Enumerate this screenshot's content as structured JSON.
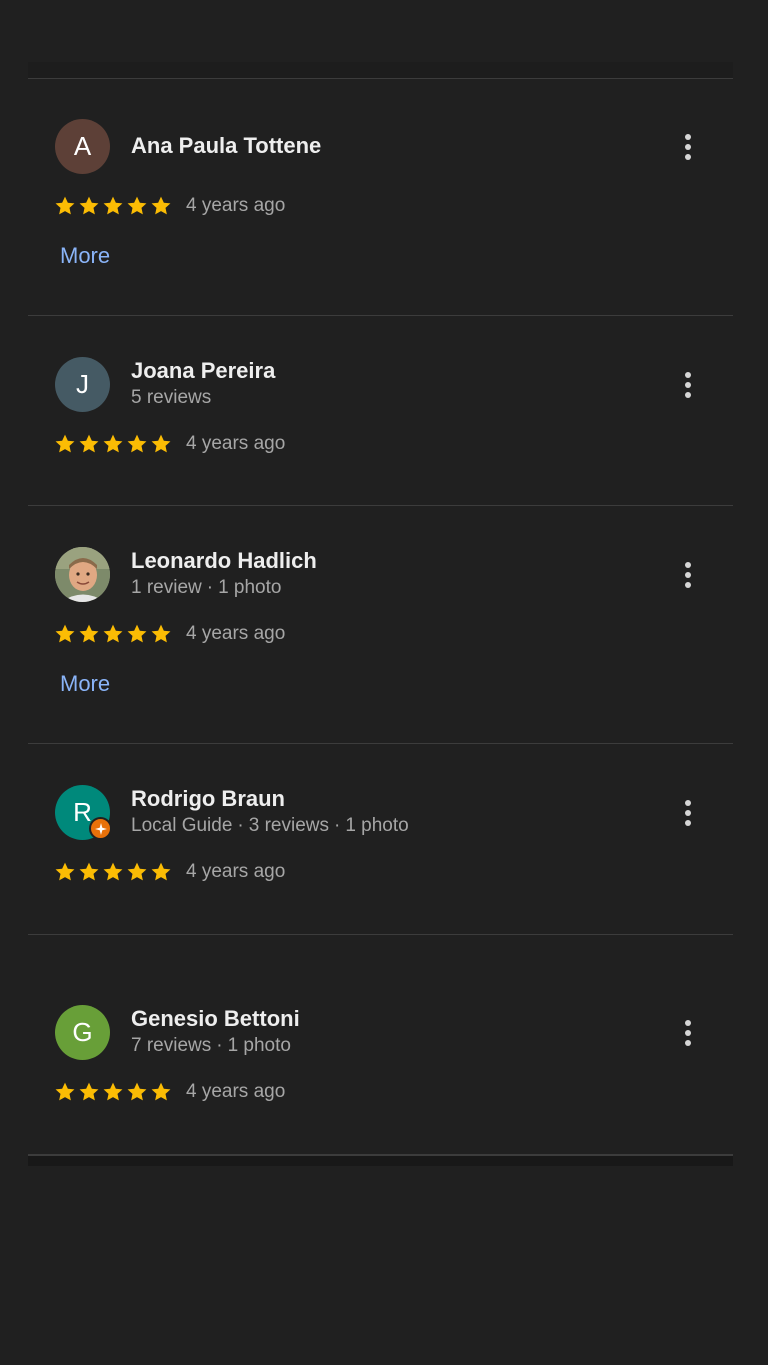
{
  "colors": {
    "background": "#202020",
    "divider": "#3c3c3c",
    "star": "#fbbc04",
    "link": "#8ab4f8",
    "secondary_text": "#a6a6a6"
  },
  "reviews": [
    {
      "name": "Ana Paula Tottene",
      "initial": "A",
      "avatar_color": "#5d4037",
      "meta": [],
      "rating": 5,
      "age": "4 years ago",
      "more_label": "More"
    },
    {
      "name": "Joana Pereira",
      "initial": "J",
      "avatar_color": "#455a64",
      "meta": [
        "5 reviews"
      ],
      "rating": 5,
      "age": "4 years ago"
    },
    {
      "name": "Leonardo Hadlich",
      "initial": "",
      "avatar_color": "#8a8a7a",
      "avatar_type": "photo",
      "meta": [
        "1 review",
        "1 photo"
      ],
      "rating": 5,
      "age": "4 years ago",
      "more_label": "More"
    },
    {
      "name": "Rodrigo Braun",
      "initial": "R",
      "avatar_color": "#00897b",
      "local_guide_badge": true,
      "meta": [
        "Local Guide",
        "3 reviews",
        "1 photo"
      ],
      "rating": 5,
      "age": "4 years ago"
    },
    {
      "name": "Genesio Bettoni",
      "initial": "G",
      "avatar_color": "#689f38",
      "meta": [
        "7 reviews",
        "1 photo"
      ],
      "rating": 5,
      "age": "4 years ago"
    }
  ],
  "icons": {
    "menu": "more-vert-icon",
    "star": "star-icon",
    "badge": "local-guide-badge-icon"
  }
}
